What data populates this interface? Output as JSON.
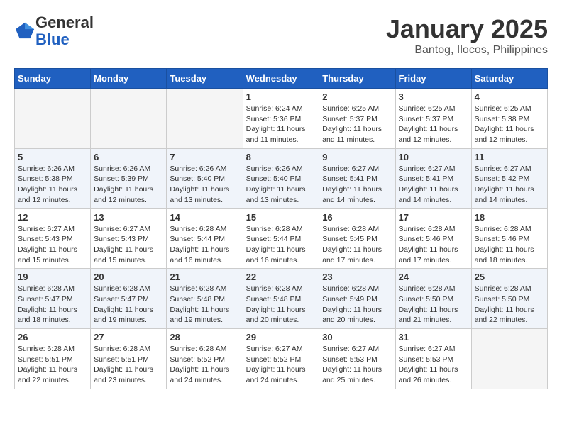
{
  "logo": {
    "general": "General",
    "blue": "Blue"
  },
  "header": {
    "title": "January 2025",
    "subtitle": "Bantog, Ilocos, Philippines"
  },
  "weekdays": [
    "Sunday",
    "Monday",
    "Tuesday",
    "Wednesday",
    "Thursday",
    "Friday",
    "Saturday"
  ],
  "weeks": [
    [
      {
        "day": "",
        "info": ""
      },
      {
        "day": "",
        "info": ""
      },
      {
        "day": "",
        "info": ""
      },
      {
        "day": "1",
        "info": "Sunrise: 6:24 AM\nSunset: 5:36 PM\nDaylight: 11 hours and 11 minutes."
      },
      {
        "day": "2",
        "info": "Sunrise: 6:25 AM\nSunset: 5:37 PM\nDaylight: 11 hours and 11 minutes."
      },
      {
        "day": "3",
        "info": "Sunrise: 6:25 AM\nSunset: 5:37 PM\nDaylight: 11 hours and 12 minutes."
      },
      {
        "day": "4",
        "info": "Sunrise: 6:25 AM\nSunset: 5:38 PM\nDaylight: 11 hours and 12 minutes."
      }
    ],
    [
      {
        "day": "5",
        "info": "Sunrise: 6:26 AM\nSunset: 5:38 PM\nDaylight: 11 hours and 12 minutes."
      },
      {
        "day": "6",
        "info": "Sunrise: 6:26 AM\nSunset: 5:39 PM\nDaylight: 11 hours and 12 minutes."
      },
      {
        "day": "7",
        "info": "Sunrise: 6:26 AM\nSunset: 5:40 PM\nDaylight: 11 hours and 13 minutes."
      },
      {
        "day": "8",
        "info": "Sunrise: 6:26 AM\nSunset: 5:40 PM\nDaylight: 11 hours and 13 minutes."
      },
      {
        "day": "9",
        "info": "Sunrise: 6:27 AM\nSunset: 5:41 PM\nDaylight: 11 hours and 14 minutes."
      },
      {
        "day": "10",
        "info": "Sunrise: 6:27 AM\nSunset: 5:41 PM\nDaylight: 11 hours and 14 minutes."
      },
      {
        "day": "11",
        "info": "Sunrise: 6:27 AM\nSunset: 5:42 PM\nDaylight: 11 hours and 14 minutes."
      }
    ],
    [
      {
        "day": "12",
        "info": "Sunrise: 6:27 AM\nSunset: 5:43 PM\nDaylight: 11 hours and 15 minutes."
      },
      {
        "day": "13",
        "info": "Sunrise: 6:27 AM\nSunset: 5:43 PM\nDaylight: 11 hours and 15 minutes."
      },
      {
        "day": "14",
        "info": "Sunrise: 6:28 AM\nSunset: 5:44 PM\nDaylight: 11 hours and 16 minutes."
      },
      {
        "day": "15",
        "info": "Sunrise: 6:28 AM\nSunset: 5:44 PM\nDaylight: 11 hours and 16 minutes."
      },
      {
        "day": "16",
        "info": "Sunrise: 6:28 AM\nSunset: 5:45 PM\nDaylight: 11 hours and 17 minutes."
      },
      {
        "day": "17",
        "info": "Sunrise: 6:28 AM\nSunset: 5:46 PM\nDaylight: 11 hours and 17 minutes."
      },
      {
        "day": "18",
        "info": "Sunrise: 6:28 AM\nSunset: 5:46 PM\nDaylight: 11 hours and 18 minutes."
      }
    ],
    [
      {
        "day": "19",
        "info": "Sunrise: 6:28 AM\nSunset: 5:47 PM\nDaylight: 11 hours and 18 minutes."
      },
      {
        "day": "20",
        "info": "Sunrise: 6:28 AM\nSunset: 5:47 PM\nDaylight: 11 hours and 19 minutes."
      },
      {
        "day": "21",
        "info": "Sunrise: 6:28 AM\nSunset: 5:48 PM\nDaylight: 11 hours and 19 minutes."
      },
      {
        "day": "22",
        "info": "Sunrise: 6:28 AM\nSunset: 5:48 PM\nDaylight: 11 hours and 20 minutes."
      },
      {
        "day": "23",
        "info": "Sunrise: 6:28 AM\nSunset: 5:49 PM\nDaylight: 11 hours and 20 minutes."
      },
      {
        "day": "24",
        "info": "Sunrise: 6:28 AM\nSunset: 5:50 PM\nDaylight: 11 hours and 21 minutes."
      },
      {
        "day": "25",
        "info": "Sunrise: 6:28 AM\nSunset: 5:50 PM\nDaylight: 11 hours and 22 minutes."
      }
    ],
    [
      {
        "day": "26",
        "info": "Sunrise: 6:28 AM\nSunset: 5:51 PM\nDaylight: 11 hours and 22 minutes."
      },
      {
        "day": "27",
        "info": "Sunrise: 6:28 AM\nSunset: 5:51 PM\nDaylight: 11 hours and 23 minutes."
      },
      {
        "day": "28",
        "info": "Sunrise: 6:28 AM\nSunset: 5:52 PM\nDaylight: 11 hours and 24 minutes."
      },
      {
        "day": "29",
        "info": "Sunrise: 6:27 AM\nSunset: 5:52 PM\nDaylight: 11 hours and 24 minutes."
      },
      {
        "day": "30",
        "info": "Sunrise: 6:27 AM\nSunset: 5:53 PM\nDaylight: 11 hours and 25 minutes."
      },
      {
        "day": "31",
        "info": "Sunrise: 6:27 AM\nSunset: 5:53 PM\nDaylight: 11 hours and 26 minutes."
      },
      {
        "day": "",
        "info": ""
      }
    ]
  ]
}
